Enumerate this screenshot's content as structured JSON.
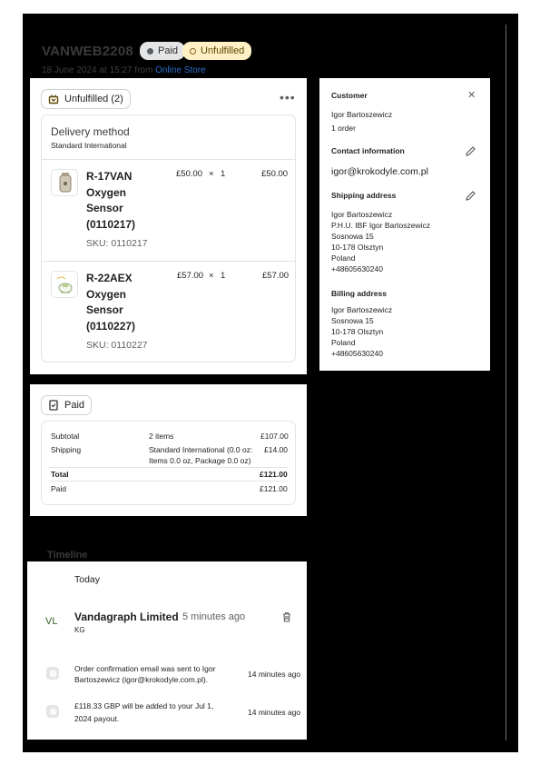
{
  "order": {
    "id": "VANWEB2208",
    "payment_badge": "Paid",
    "fulfillment_badge": "Unfulfilled",
    "date_prefix": "18 June 2024 at 15:27 from ",
    "channel": "Online Store"
  },
  "fulfillment": {
    "status_label": "Unfulfilled (2)",
    "more_label": "•••",
    "delivery_title": "Delivery method",
    "delivery_value": "Standard International",
    "items": [
      {
        "name": "R-17VAN Oxygen Sensor (0110217)",
        "sku": "SKU: 0110217",
        "price": "£50.00",
        "times": "×",
        "qty": "1",
        "total": "£50.00"
      },
      {
        "name": "R-22AEX Oxygen Sensor (0110227)",
        "sku": "SKU: 0110227",
        "price": "£57.00",
        "times": "×",
        "qty": "1",
        "total": "£57.00"
      }
    ]
  },
  "payment": {
    "status_label": "Paid",
    "subtotal_label": "Subtotal",
    "subtotal_items": "2 items",
    "subtotal_value": "£107.00",
    "shipping_label": "Shipping",
    "shipping_desc_1": "Standard International (0.0 oz:",
    "shipping_desc_2": "Items 0.0 oz, Package 0.0 oz)",
    "shipping_value": "£14.00",
    "total_label": "Total",
    "total_value": "£121.00",
    "paid_label": "Paid",
    "paid_value": "£121.00"
  },
  "customer": {
    "heading": "Customer",
    "close_label": "✕",
    "name": "Igor Bartoszewicz",
    "orders": "1 order",
    "contact_heading": "Contact information",
    "email": "igor@krokodyle.com.pl",
    "shipping_heading": "Shipping address",
    "shipping_lines": [
      "Igor Bartoszewicz",
      "P.H.U. IBF Igor Bartoszewicz",
      "Sosnowa 15",
      "10-178 Olsztyn",
      "Poland",
      "+48605630240"
    ],
    "billing_heading": "Billing address",
    "billing_lines": [
      "Igor Bartoszewicz",
      "Sosnowa 15",
      "10-178 Olsztyn",
      "Poland",
      "+48605630240"
    ]
  },
  "timeline": {
    "title": "Timeline",
    "day": "Today",
    "comment_initials": "VL",
    "comment_author": "Vandagraph Limited",
    "comment_time": "5 minutes ago",
    "comment_text": "KG",
    "events": [
      {
        "text_1": "Order confirmation email was sent to Igor",
        "text_2": "Bartoszewicz (igor@krokodyle.com.pl).",
        "time": "14 minutes ago"
      },
      {
        "text_1": "£118.33 GBP will be added to your Jul 1,",
        "text_2": "2024 payout.",
        "time": "14 minutes ago"
      }
    ]
  },
  "colors": {
    "frame": "#000000",
    "link": "#2c6ecb",
    "initials": "#2e5e1f",
    "unfulfilled_bg": "#fff0c6"
  }
}
